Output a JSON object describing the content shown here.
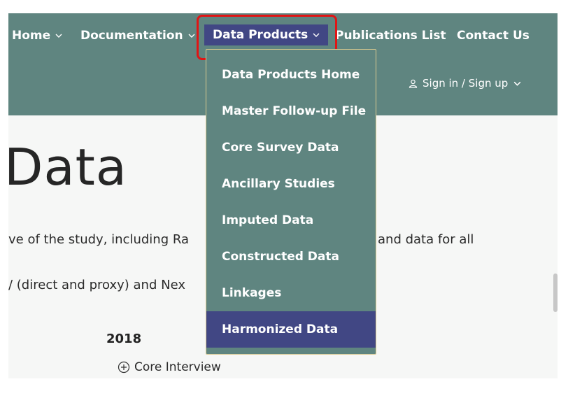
{
  "nav": {
    "home": "Home",
    "documentation": "Documentation",
    "data_products": "Data Products",
    "publications": "Publications List",
    "contact": "Contact Us",
    "signin": "Sign in / Sign up"
  },
  "dropdown": {
    "items": [
      "Data Products Home",
      "Master Follow-up File",
      "Core Survey Data",
      "Ancillary Studies",
      "Imputed Data",
      "Constructed Data",
      "Linkages",
      "Harmonized Data"
    ],
    "active_item": "Harmonized Data"
  },
  "main": {
    "heading": "Data",
    "line1_left": "ve of the study, including Ra",
    "line1_right": "and data for all",
    "line2_left": "/ (direct and proxy) and Nex",
    "year": "2018",
    "core_interview": "Core Interview"
  },
  "colors": {
    "nav_bg": "#5f8580",
    "active_bg": "#414784",
    "highlight": "#e01515"
  }
}
